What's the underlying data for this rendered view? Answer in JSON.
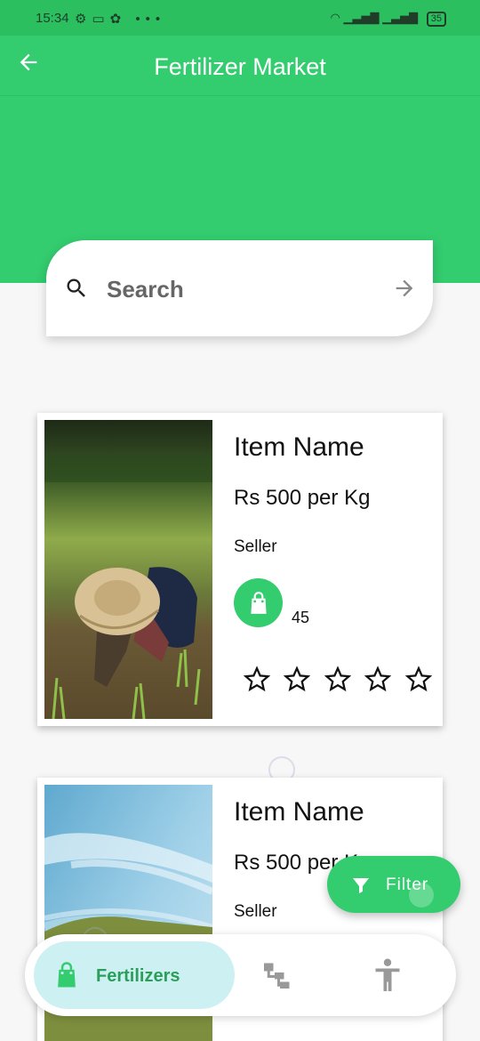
{
  "status_bar": {
    "time": "15:34",
    "battery": "35"
  },
  "app_bar": {
    "title": "Fertilizer Market"
  },
  "search": {
    "placeholder": "Search"
  },
  "items": [
    {
      "name": "Item Name",
      "price": "Rs 500 per Kg",
      "seller": "Seller",
      "count": "45",
      "rating": 0
    },
    {
      "name": "Item Name",
      "price": "Rs 500 per Kg",
      "seller": "Seller"
    }
  ],
  "fab": {
    "label": "Filter"
  },
  "bottom_nav": {
    "active_label": "Fertilizers",
    "icons": [
      "shopping-bag-icon",
      "tree-structure-icon",
      "accessibility-icon"
    ]
  },
  "colors": {
    "primary": "#33cc6f",
    "nav_active_bg": "#cdf0f3",
    "nav_active_text": "#2b9f5a"
  }
}
